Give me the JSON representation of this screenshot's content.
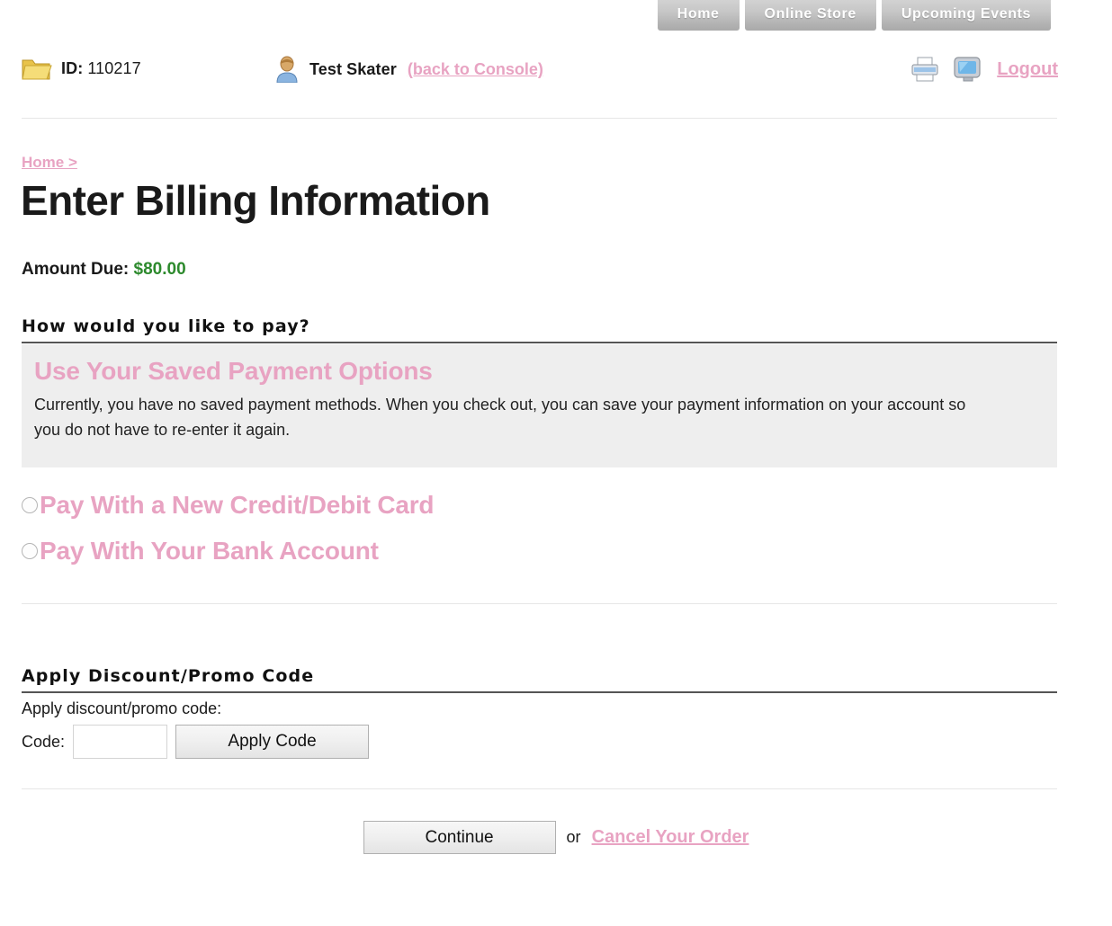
{
  "topnav": {
    "items": [
      {
        "label": "Home",
        "name": "nav-home"
      },
      {
        "label": "Online Store",
        "name": "nav-online-store"
      },
      {
        "label": "Upcoming Events",
        "name": "nav-upcoming-events"
      }
    ]
  },
  "userbar": {
    "folder_icon": "folder-icon",
    "id_label": "ID:",
    "id_value": "110217",
    "person_icon": "person-icon",
    "user_name": "Test Skater",
    "back_to_console": "(back to Console)",
    "printer_icon": "printer-icon",
    "monitor_icon": "monitor-icon",
    "logout": "Logout"
  },
  "page": {
    "breadcrumb": "Home >",
    "title": "Enter Billing Information",
    "amount_label": "Amount Due:",
    "amount_value": "$80.00"
  },
  "payment_section": {
    "heading": "How would you like to pay?",
    "saved_title": "Use Your Saved Payment Options",
    "saved_text": "Currently, you have no saved payment methods. When you check out, you can save your payment information on your account so you do not have to re-enter it again.",
    "options": [
      {
        "label": "Pay With a New Credit/Debit Card",
        "selected": false
      },
      {
        "label": "Pay With Your Bank Account",
        "selected": false
      }
    ]
  },
  "promo_section": {
    "heading": "Apply Discount/Promo Code",
    "subtext": "Apply discount/promo code:",
    "code_label": "Code:",
    "code_value": "",
    "code_placeholder": "",
    "apply_button": "Apply Code"
  },
  "footer": {
    "continue_button": "Continue",
    "or_text": "or",
    "cancel_link": "Cancel Your Order"
  },
  "colors": {
    "pink": "#e8a3c2",
    "green": "#2d8a2d",
    "box_gray": "#eeeeee",
    "rule_gray": "#e6e6e6",
    "heading_rule": "#555555"
  }
}
